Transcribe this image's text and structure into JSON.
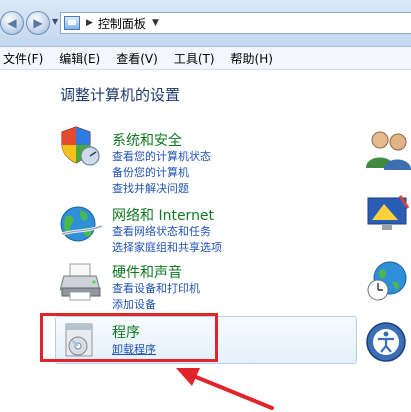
{
  "address_bar": {
    "path": "控制面板"
  },
  "menu": {
    "items": [
      "文件(F)",
      "编辑(E)",
      "查看(V)",
      "工具(T)",
      "帮助(H)"
    ]
  },
  "main": {
    "title": "调整计算机的设置",
    "categories": [
      {
        "title": "系统和安全",
        "links": [
          "查看您的计算机状态",
          "备份您的计算机",
          "查找并解决问题"
        ]
      },
      {
        "title": "网络和 Internet",
        "links": [
          "查看网络状态和任务",
          "选择家庭组和共享选项"
        ]
      },
      {
        "title": "硬件和声音",
        "links": [
          "查看设备和打印机",
          "添加设备"
        ]
      },
      {
        "title": "程序",
        "links": [
          "卸载程序"
        ]
      }
    ]
  },
  "colors": {
    "category_title": "#0e7a1e",
    "link": "#1f53b8",
    "annotation_red": "#e0242a"
  }
}
